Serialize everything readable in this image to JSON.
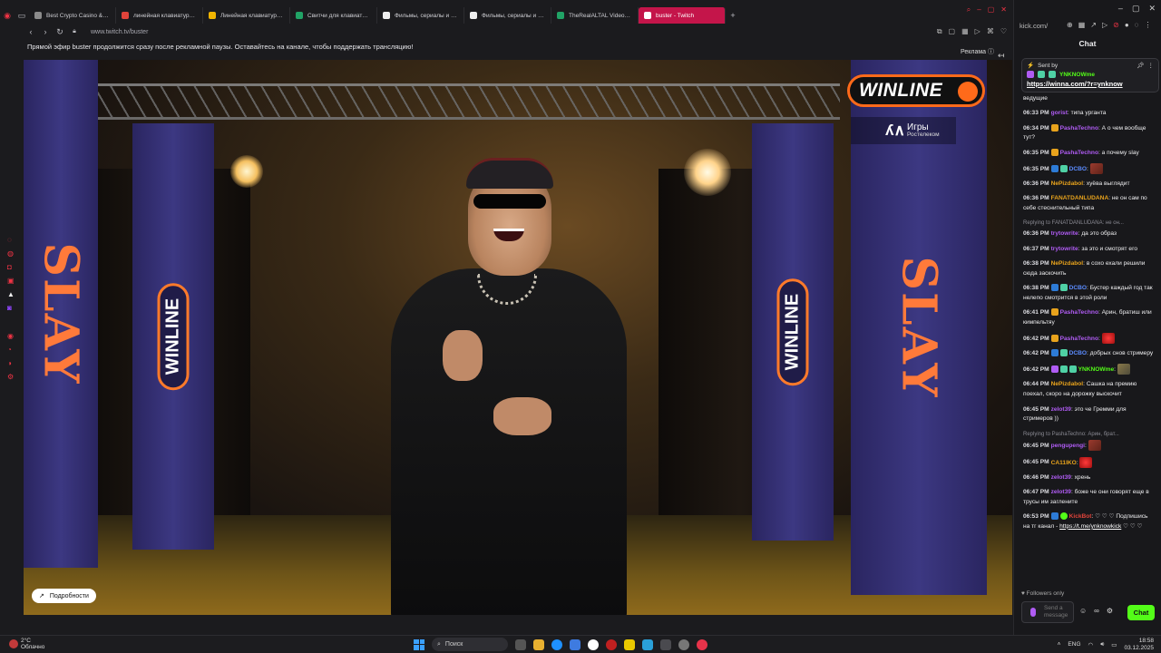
{
  "tabs": [
    {
      "label": "Best Crypto Casino & Bit",
      "color": "#8b8b8b"
    },
    {
      "label": "линейная клавиатура и",
      "color": "#e0433a"
    },
    {
      "label": "Линейная клавиатура и",
      "color": "#f0b400"
    },
    {
      "label": "Свитчи для клавиатуры",
      "color": "#21a366"
    },
    {
      "label": "Фильмы, сериалы и мул",
      "color": "#eeeeee"
    },
    {
      "label": "Фильмы, сериалы и мул",
      "color": "#eeeeee"
    },
    {
      "label": "TheRealALTAL Videos - V",
      "color": "#21a366"
    },
    {
      "label": "buster - Twitch",
      "color": "#ffffff",
      "active": true
    }
  ],
  "browser": {
    "url": "www.twitch.tv/buster",
    "notice": "Прямой эфир buster продолжится сразу после рекламной паузы. Оставайтесь на канале, чтобы поддержать трансляцию!",
    "ad_label": "Реклама"
  },
  "video": {
    "sponsor": "WINLINE",
    "partner_line1": "Игры",
    "partner_line2": "Ростелеком",
    "banner_left_text": "SLAY",
    "banner_right_text": "SLAY",
    "details_button": "Подробности"
  },
  "kick": {
    "url": "kick.com/",
    "chat_title": "Chat",
    "pinned": {
      "sent_by_label": "Sent by",
      "username": "YNKNOWme",
      "link": "https://winna.com/?r=ynknow"
    },
    "partial_top": "ведущие",
    "messages": [
      {
        "time": "06:33 PM",
        "user": "gorist",
        "color": "#b05cf4",
        "badges": [],
        "text": "типа урганта"
      },
      {
        "time": "06:34 PM",
        "user": "PashaTechno",
        "color": "#b05cf4",
        "badges": [
          "sub"
        ],
        "text": "А о чем вообще тут?"
      },
      {
        "time": "06:35 PM",
        "user": "PashaTechno",
        "color": "#b05cf4",
        "badges": [
          "sub"
        ],
        "text": "а почему slay"
      },
      {
        "time": "06:35 PM",
        "user": "DCBO",
        "color": "#5b8cff",
        "badges": [
          "mod",
          "vip"
        ],
        "text": "",
        "emote": "e"
      },
      {
        "time": "06:36 PM",
        "user": "NePizdabol",
        "color": "#e8a31c",
        "badges": [],
        "text": "хуёва выглядит"
      },
      {
        "time": "06:36 PM",
        "user": "FANATDANLUDANA",
        "color": "#e8a31c",
        "badges": [],
        "text": "не он сам по себе стеснительный типа"
      },
      {
        "reply": "Replying to FANATDANLUDANA: не он...",
        "time": "06:36 PM",
        "user": "trytowrite",
        "color": "#b05cf4",
        "badges": [],
        "text": "да это образ"
      },
      {
        "time": "06:37 PM",
        "user": "trytowrite",
        "color": "#b05cf4",
        "badges": [],
        "text": "за это и смотрят его"
      },
      {
        "time": "06:38 PM",
        "user": "NePizdabol",
        "color": "#e8a31c",
        "badges": [],
        "text": "в сохо ехали решили сюда заскочить"
      },
      {
        "time": "06:38 PM",
        "user": "DCBO",
        "color": "#5b8cff",
        "badges": [
          "mod",
          "vip"
        ],
        "text": "Бустер каждый год так нелепо смотрится в этой роли"
      },
      {
        "time": "06:41 PM",
        "user": "PashaTechno",
        "color": "#b05cf4",
        "badges": [
          "sub"
        ],
        "text": "Арин, братиш или кимпельтяу"
      },
      {
        "time": "06:42 PM",
        "user": "PashaTechno",
        "color": "#b05cf4",
        "badges": [
          "sub"
        ],
        "text": "",
        "emote": "r"
      },
      {
        "time": "06:42 PM",
        "user": "DCBO",
        "color": "#5b8cff",
        "badges": [
          "mod",
          "vip"
        ],
        "text": "добрых снов стримеру"
      },
      {
        "time": "06:42 PM",
        "user": "YNKNOWme",
        "color": "#53fc18",
        "badges": [
          "og",
          "vip",
          "vip"
        ],
        "text": "",
        "emote": "g"
      },
      {
        "time": "06:44 PM",
        "user": "NePizdabol",
        "color": "#e8a31c",
        "badges": [],
        "text": "Сашка на премию поехал, скоро на дорожку выскочит"
      },
      {
        "time": "06:45 PM",
        "user": "zelot39",
        "color": "#b05cf4",
        "badges": [],
        "text": "это че Гремми для стримеров ))"
      },
      {
        "reply": "Replying to PashaTechno: Арин, брат...",
        "time": "06:45 PM",
        "user": "pengupengi",
        "color": "#b05cf4",
        "badges": [],
        "text": "",
        "emote": "e"
      },
      {
        "time": "06:45 PM",
        "user": "CA11IKO",
        "color": "#e8a31c",
        "badges": [],
        "text": "",
        "emote": "r"
      },
      {
        "time": "06:46 PM",
        "user": "zelot39",
        "color": "#b05cf4",
        "badges": [],
        "text": "хрень"
      },
      {
        "time": "06:47 PM",
        "user": "zelot39",
        "color": "#b05cf4",
        "badges": [],
        "text": "боже че они говорят еще в трусы им заглените"
      },
      {
        "time": "06:53 PM",
        "user": "KickBot",
        "color": "#e0433a",
        "badges": [
          "mod",
          "ver"
        ],
        "text": "♡ ♡ ♡ Подпишись на тг канал - ",
        "link": "https://t.me/ynknowkick",
        "tail": " ♡ ♡ ♡"
      }
    ],
    "followers_only": "Followers only",
    "input_placeholder": "Send a message",
    "send_label": "Chat"
  },
  "taskbar": {
    "temp": "2°C",
    "condition": "Облачно",
    "search": "Поиск",
    "lang": "ENG",
    "time": "18:58",
    "date": "03.12.2025"
  }
}
